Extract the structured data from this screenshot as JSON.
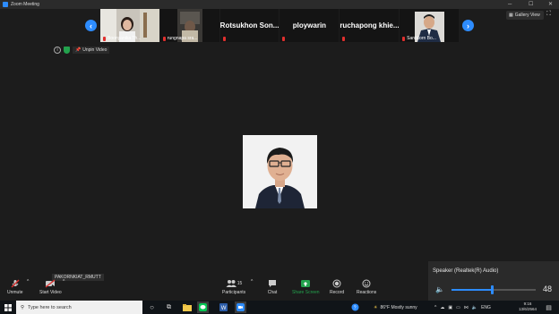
{
  "window": {
    "title": "Zoom Meeting"
  },
  "gallery": {
    "prev_label": "‹",
    "next_label": "›",
    "view_button_label": "Gallery View",
    "tiles": [
      {
        "type": "video",
        "name": "Boonyanika Th..."
      },
      {
        "type": "video",
        "name": "rungnapa sra..."
      },
      {
        "type": "name",
        "name": "Rotsukhon Son..."
      },
      {
        "type": "name",
        "name": "ploywarin"
      },
      {
        "type": "name",
        "name": "ruchapong khie..."
      },
      {
        "type": "video",
        "name": "Santikorn Bo..."
      }
    ]
  },
  "infobar": {
    "unpin_label": "Unpin Video"
  },
  "self_name": "PAKORNKIAT_RMUTT",
  "controls": {
    "unmute": "Unmute",
    "start_video": "Start Video",
    "participants": "Participants",
    "participants_count": "15",
    "chat": "Chat",
    "share_screen": "Share Screen",
    "record": "Record",
    "reactions": "Reactions"
  },
  "audio": {
    "device": "Speaker (Realtek(R) Audio)",
    "volume": "48",
    "volume_fraction": 0.48
  },
  "taskbar": {
    "search_placeholder": "Type here to search",
    "weather": "86°F  Mostly sunny",
    "lang": "ENG",
    "time": "9:16",
    "date": "13/6/2564"
  },
  "colors": {
    "accent": "#2d8cff",
    "share": "#23a24d",
    "muted": "#e0302e"
  }
}
